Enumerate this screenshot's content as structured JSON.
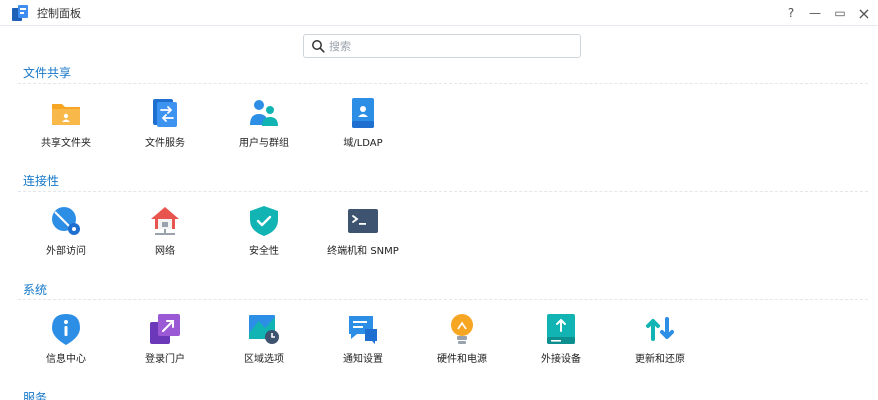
{
  "window": {
    "title": "控制面板",
    "help_glyph": "?",
    "minimize_glyph": "—",
    "maximize_glyph": "▭",
    "close_glyph": "×"
  },
  "search": {
    "placeholder": "搜索",
    "value": ""
  },
  "sections": {
    "file_sharing": {
      "title": "文件共享",
      "items": [
        {
          "label": "共享文件夹",
          "icon": "shared-folder-icon"
        },
        {
          "label": "文件服务",
          "icon": "file-services-icon"
        },
        {
          "label": "用户与群组",
          "icon": "user-group-icon"
        },
        {
          "label": "域/LDAP",
          "icon": "domain-ldap-icon"
        }
      ]
    },
    "connectivity": {
      "title": "连接性",
      "items": [
        {
          "label": "外部访问",
          "icon": "external-access-icon"
        },
        {
          "label": "网络",
          "icon": "network-icon"
        },
        {
          "label": "安全性",
          "icon": "security-shield-icon"
        },
        {
          "label": "终端机和 SNMP",
          "icon": "terminal-snmp-icon"
        }
      ]
    },
    "system": {
      "title": "系统",
      "items": [
        {
          "label": "信息中心",
          "icon": "info-center-icon"
        },
        {
          "label": "登录门户",
          "icon": "login-portal-icon"
        },
        {
          "label": "区域选项",
          "icon": "regional-options-icon"
        },
        {
          "label": "通知设置",
          "icon": "notification-icon"
        },
        {
          "label": "硬件和电源",
          "icon": "hardware-power-icon"
        },
        {
          "label": "外接设备",
          "icon": "external-devices-icon"
        },
        {
          "label": "更新和还原",
          "icon": "update-restore-icon"
        }
      ]
    },
    "services": {
      "title": "服务"
    }
  },
  "colors": {
    "section_title": "#1477c9",
    "folder_orange": "#f6a623",
    "primary_blue": "#2d8ee6",
    "teal": "#11b3b3"
  }
}
